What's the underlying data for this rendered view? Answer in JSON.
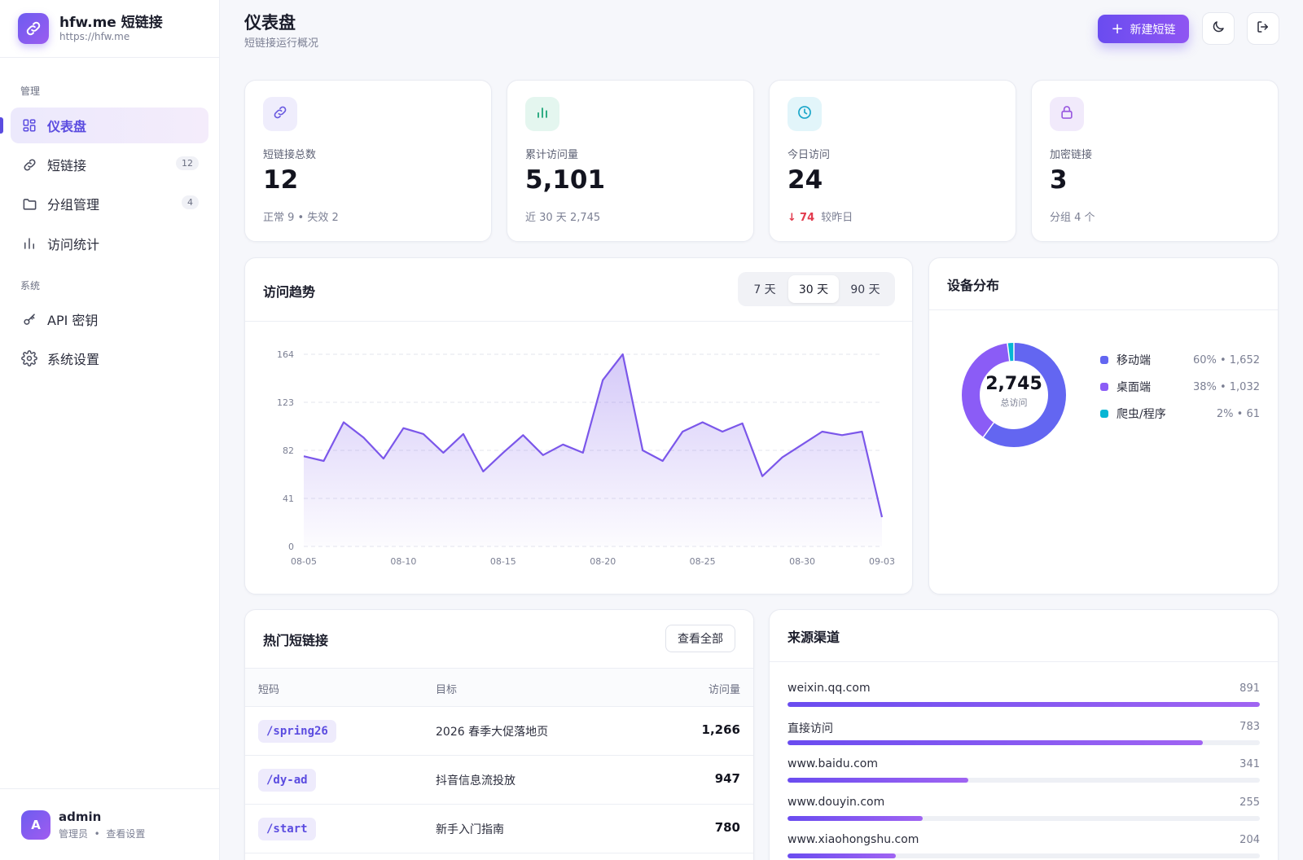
{
  "brand": {
    "name": "hfw.me 短链接",
    "url": "https://hfw.me"
  },
  "nav": {
    "section_manage": "管理",
    "section_system": "系统",
    "items": [
      {
        "label": "仪表盘",
        "icon": "dashboard-icon",
        "active": true,
        "badge": ""
      },
      {
        "label": "短链接",
        "icon": "link-icon",
        "active": false,
        "badge": "12"
      },
      {
        "label": "分组管理",
        "icon": "folder-icon",
        "active": false,
        "badge": "4"
      },
      {
        "label": "访问统计",
        "icon": "bar-chart-icon",
        "active": false,
        "badge": ""
      },
      {
        "label": "API 密钥",
        "icon": "key-icon",
        "active": false,
        "badge": ""
      },
      {
        "label": "系统设置",
        "icon": "gear-icon",
        "active": false,
        "badge": ""
      }
    ]
  },
  "user": {
    "avatar": "A",
    "name": "admin",
    "role": "管理员",
    "settings_link": "查看设置"
  },
  "header": {
    "title": "仪表盘",
    "subtitle": "短链接运行概况",
    "new_button": "新建短链"
  },
  "stats": [
    {
      "label": "短链接总数",
      "value": "12",
      "foot": "正常 9 • 失效 2",
      "icon": "link-icon",
      "color": "#6a5ae0",
      "bg": "#efedfc"
    },
    {
      "label": "累计访问量",
      "value": "5,101",
      "foot": "近 30 天 2,745",
      "icon": "bar-chart-icon",
      "color": "#1fa67a",
      "bg": "#e4f6ef"
    },
    {
      "label": "今日访问",
      "value": "24",
      "foot_delta": "74",
      "foot_text": "较昨日",
      "icon": "clock-icon",
      "color": "#1aa6c9",
      "bg": "#e2f5fa"
    },
    {
      "label": "加密链接",
      "value": "3",
      "foot": "分组 4 个",
      "icon": "lock-icon",
      "color": "#9a5ae0",
      "bg": "#f1eafb"
    }
  ],
  "trend": {
    "title": "访问趋势",
    "ranges": [
      "7 天",
      "30 天",
      "90 天"
    ],
    "selected_range": "30 天"
  },
  "chart_data": {
    "type": "area",
    "title": "访问趋势",
    "x": [
      "08-05",
      "08-06",
      "08-07",
      "08-08",
      "08-09",
      "08-10",
      "08-11",
      "08-12",
      "08-13",
      "08-14",
      "08-15",
      "08-16",
      "08-17",
      "08-18",
      "08-19",
      "08-20",
      "08-21",
      "08-22",
      "08-23",
      "08-24",
      "08-25",
      "08-26",
      "08-27",
      "08-28",
      "08-29",
      "08-30",
      "08-31",
      "09-01",
      "09-02",
      "09-03"
    ],
    "x_ticks": [
      "08-05",
      "08-10",
      "08-15",
      "08-20",
      "08-25",
      "08-30",
      "09-03"
    ],
    "series": [
      {
        "values": [
          77,
          73,
          106,
          93,
          75,
          101,
          96,
          80,
          96,
          64,
          80,
          95,
          78,
          87,
          80,
          142,
          164,
          82,
          73,
          98,
          106,
          98,
          105,
          60,
          76,
          87,
          98,
          95,
          98,
          25
        ]
      }
    ],
    "y_ticks": [
      0,
      41,
      82,
      123,
      164
    ],
    "ylim": [
      0,
      164
    ],
    "grid": true,
    "color": "#7b57ea"
  },
  "devices": {
    "title": "设备分布",
    "total": "2,745",
    "total_label": "总访问",
    "items": [
      {
        "name": "移动端",
        "percent": 60,
        "count": "1,652",
        "color": "#6366f1"
      },
      {
        "name": "桌面端",
        "percent": 38,
        "count": "1,032",
        "color": "#8b5cf6"
      },
      {
        "name": "爬虫/程序",
        "percent": 2,
        "count": "61",
        "color": "#06b6d4"
      }
    ]
  },
  "hot_links": {
    "title": "热门短链接",
    "view_all": "查看全部",
    "columns": [
      "短码",
      "目标",
      "访问量"
    ],
    "rows": [
      {
        "code": "/spring26",
        "target": "2026 春季大促落地页",
        "visits": "1,266"
      },
      {
        "code": "/dy-ad",
        "target": "抖音信息流投放",
        "visits": "947"
      },
      {
        "code": "/start",
        "target": "新手入门指南",
        "visits": "780"
      }
    ]
  },
  "sources": {
    "title": "来源渠道",
    "items": [
      {
        "name": "weixin.qq.com",
        "count": 891
      },
      {
        "name": "直接访问",
        "count": 783
      },
      {
        "name": "www.baidu.com",
        "count": 341
      },
      {
        "name": "www.douyin.com",
        "count": 255
      },
      {
        "name": "www.xiaohongshu.com",
        "count": 204
      }
    ]
  }
}
